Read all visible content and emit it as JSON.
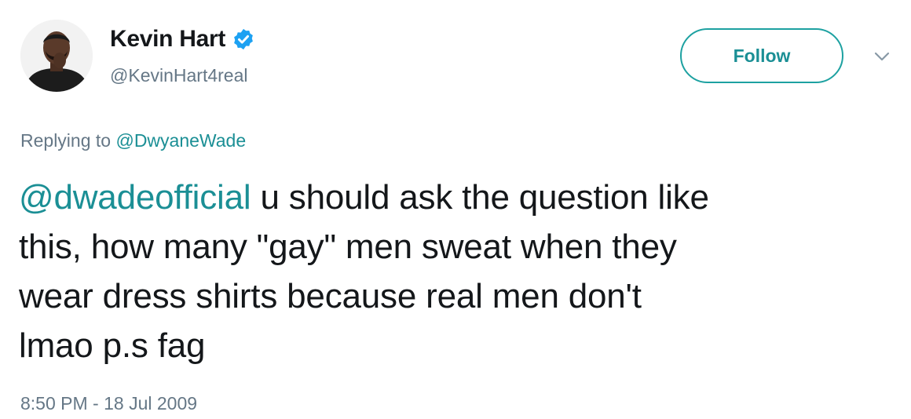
{
  "author": {
    "display_name": "Kevin Hart",
    "handle": "@KevinHart4real",
    "verified": true,
    "avatar_icon": "profile-photo"
  },
  "follow_button": {
    "label": "Follow"
  },
  "menu_caret_icon": "chevron-down-icon",
  "reply_context": {
    "prefix": "Replying to",
    "mention": "@DwyaneWade"
  },
  "tweet": {
    "mention": "@dwadeofficial",
    "line1_rest": "u should ask the question like",
    "line2": "this, how many \"gay\" men sweat when they",
    "line3": "wear dress shirts because real men don't",
    "line4": "lmao p.s fag"
  },
  "timestamp": "8:50 PM - 18 Jul 2009",
  "colors": {
    "accent": "#1b8f95",
    "text": "#14171a",
    "secondary": "#657786",
    "verified_badge": "#1da1f2"
  }
}
